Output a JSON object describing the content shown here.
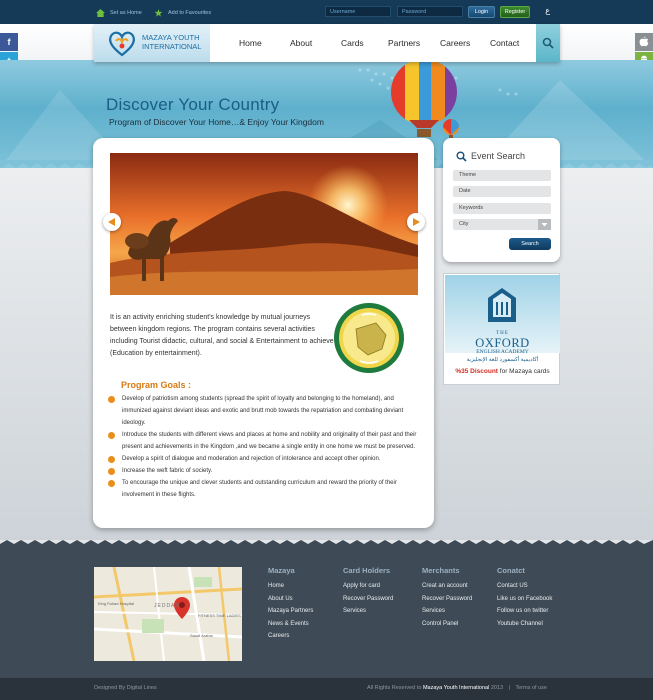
{
  "topbar": {
    "set_home": "Set as Home",
    "add_favourites": "Add to Favourites",
    "username_placeholder": "Username",
    "password_placeholder": "Password",
    "login_label": "Login",
    "register_label": "Register",
    "language_label": "ع"
  },
  "social": {
    "facebook": "f",
    "twitter": "t"
  },
  "brand": {
    "name": "MAZAYA YOUTH INTERNATIONAL"
  },
  "nav": {
    "items": [
      {
        "label": "Home"
      },
      {
        "label": "About"
      },
      {
        "label": "Cards"
      },
      {
        "label": "Partners"
      },
      {
        "label": "Careers"
      },
      {
        "label": "Contact"
      }
    ]
  },
  "hero": {
    "title": "Discover Your Country",
    "subtitle": "Program of Discover Your Home…& Enjoy Your Kingdom"
  },
  "content": {
    "intro": "It is an activity enriching student's knowledge by mutual journeys between kingdom regions. The program contains several activities including Tourist didactic, cultural, and social & Entertainment to achieve (Education by entertainment).",
    "goals_title": "Program Goals :",
    "goals": [
      "Develop of patriotism among students (spread the spirit of loyalty and belonging to the homeland), and immunized against deviant ideas and exotic and brutt mob towards the repatriation and combating deviant ideology.",
      "Introduce the students with different views and places at home and nobility and originality of their past and their present and achievements in the Kingdom ,and we became a single entity in one home we must be preserved.",
      "Develop a spirit of dialogue and moderation and rejection of intolerance and accept other opinion.",
      "Increase the weft fabric of society.",
      "To encourage the unique and clever students and outstanding curriculum and reward the priority of their involvement in these flights."
    ]
  },
  "event_search": {
    "title": "Event Search",
    "theme_placeholder": "Theme",
    "date_placeholder": "Date",
    "keywords_placeholder": "Keywords",
    "city_value": "City",
    "search_label": "Search"
  },
  "ad": {
    "line1": "THE",
    "line2": "OXFORD",
    "line3": "ENGLISH ACADEMY",
    "line4": "أكاديمية أكسفورد للغة الإنجليزية",
    "discount": "%35 Discount",
    "offer": " for Mazaya cards"
  },
  "footer": {
    "columns": [
      {
        "title": "Mazaya",
        "links": [
          "Home",
          "About Us",
          "Mazaya Partners",
          "News & Events",
          "Careers"
        ]
      },
      {
        "title": "Card Holders",
        "links": [
          "Apply for card",
          "Recover Password",
          "Services"
        ]
      },
      {
        "title": "Merchants",
        "links": [
          "Creat an account",
          "Recover Password",
          "Services",
          "Control Panel"
        ]
      },
      {
        "title": "Conatct",
        "links": [
          "Contact US",
          "Like us on Facebook",
          "Follow us on twitter",
          "Youtube Channel"
        ]
      }
    ],
    "map_labels": [
      "JEDDAH",
      "King Fahad Hospital",
      "FITNESS TIME LADIES",
      "Saudi Arabia"
    ],
    "designed_by": "Designed By Digital Lines",
    "rights_prefix": "All Rights Reserved to ",
    "rights_name": "Mazaya Youth International",
    "rights_year": "2013",
    "separator": "|",
    "terms": "Terms of use"
  },
  "colors": {
    "accent_orange": "#e98d1c",
    "brand_blue": "#1b6fa4",
    "navy": "#143a57"
  }
}
